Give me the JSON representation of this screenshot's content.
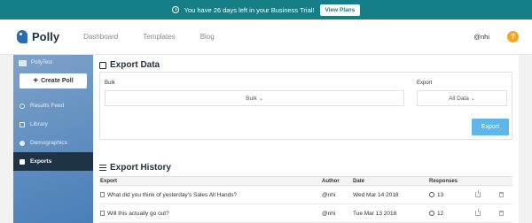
{
  "banner": {
    "message": "You have 26 days left in your Business Trial!",
    "button": "View Plans"
  },
  "nav": {
    "brand": "Polly",
    "links": [
      "Dashboard",
      "Templates",
      "Blog"
    ],
    "user": "@nhi",
    "help": "?"
  },
  "sidebar": {
    "poll_name": "PollyTest",
    "create_button": "Create Poll",
    "items": [
      {
        "label": "Results Feed",
        "icon": "feed-icon"
      },
      {
        "label": "Library",
        "icon": "library-icon"
      },
      {
        "label": "Demographics",
        "icon": "demographics-icon"
      },
      {
        "label": "Exports",
        "icon": "exports-icon",
        "active": true
      }
    ]
  },
  "export": {
    "title": "Export Data",
    "bulk_label": "Bulk",
    "bulk_value": "Bulk",
    "export_label": "Export",
    "export_value": "All Data",
    "button": "Export"
  },
  "history": {
    "title": "Export History",
    "columns": [
      "Export",
      "Author",
      "Date",
      "Responses"
    ],
    "rows": [
      {
        "question": "What did you think of yesterday's Sales All Hands?",
        "author": "@nhi",
        "date": "Wed Mar 14 2018",
        "responses": "13"
      },
      {
        "question": "Will this actually go out?",
        "author": "@nhi",
        "date": "Tue Mar 13 2018",
        "responses": "12"
      }
    ]
  },
  "colors": {
    "banner": "#157e87",
    "accent": "#5eb7ea",
    "sidebar_active": "#1f3346",
    "help": "#f5a623"
  }
}
